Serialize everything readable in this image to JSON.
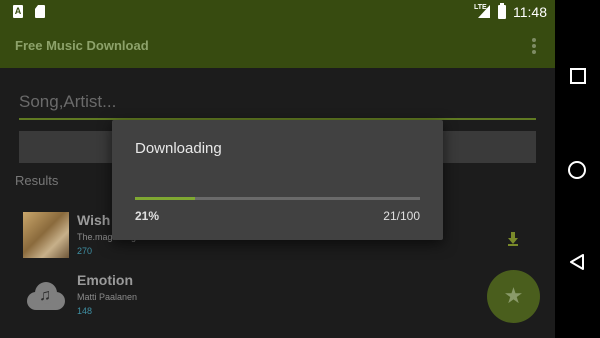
{
  "status_bar": {
    "time": "11:48",
    "network": "LTE",
    "notification_icons": [
      "a-notification-icon",
      "sd-card-icon"
    ]
  },
  "app_bar": {
    "title": "Free Music Download"
  },
  "search": {
    "placeholder": "Song,Artist..."
  },
  "results": {
    "label": "Results",
    "items": [
      {
        "title": "Wish",
        "artist": "The.magic.fingers",
        "count": "270"
      },
      {
        "title": "Emotion",
        "artist": "Matti Paalanen",
        "count": "148"
      }
    ]
  },
  "dialog": {
    "title": "Downloading",
    "progress_percent_label": "21%",
    "progress_count_label": "21/100",
    "progress_fraction": 0.21
  },
  "colors": {
    "primary": "#374b10",
    "accent": "#7fa832",
    "dialog_bg": "#414141"
  },
  "fab": {
    "icon": "star-icon"
  },
  "nav": {
    "icons": [
      "recents-square-icon",
      "home-circle-icon",
      "back-triangle-icon"
    ]
  }
}
